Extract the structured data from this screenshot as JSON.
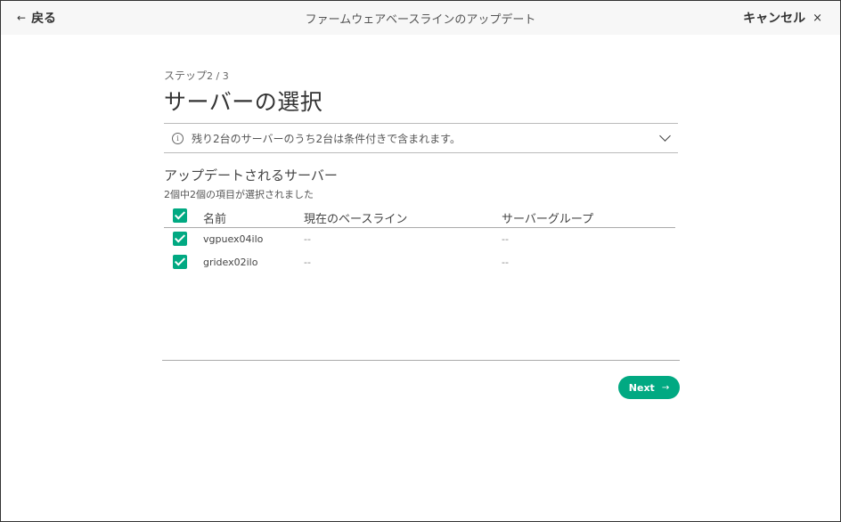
{
  "header": {
    "back_label": "戻る",
    "title": "ファームウェアベースラインのアップデート",
    "cancel_label": "キャンセル"
  },
  "wizard": {
    "step_prefix": "ステップ",
    "step_number": "2 / 3",
    "page_title": "サーバーの選択"
  },
  "info_banner": {
    "message": "残り2台のサーバーのうち2台は条件付きで含まれます。"
  },
  "servers": {
    "section_title": "アップデートされるサーバー",
    "selection_count": "2個中2個の項目が選択されました",
    "columns": [
      "名前",
      "現在のベースライン",
      "サーバーグループ"
    ],
    "rows": [
      {
        "name": "vgpuex04ilo",
        "baseline": "--",
        "group": "--",
        "checked": true
      },
      {
        "name": "gridex02ilo",
        "baseline": "--",
        "group": "--",
        "checked": true
      }
    ]
  },
  "footer": {
    "next_label": "Next"
  },
  "colors": {
    "accent": "#01a982",
    "header_bg": "#f7f7f7"
  },
  "icons": {
    "back": "arrow-left-icon",
    "cancel": "close-icon",
    "info": "info-icon",
    "expand": "chevron-down-icon",
    "next": "arrow-right-icon"
  }
}
